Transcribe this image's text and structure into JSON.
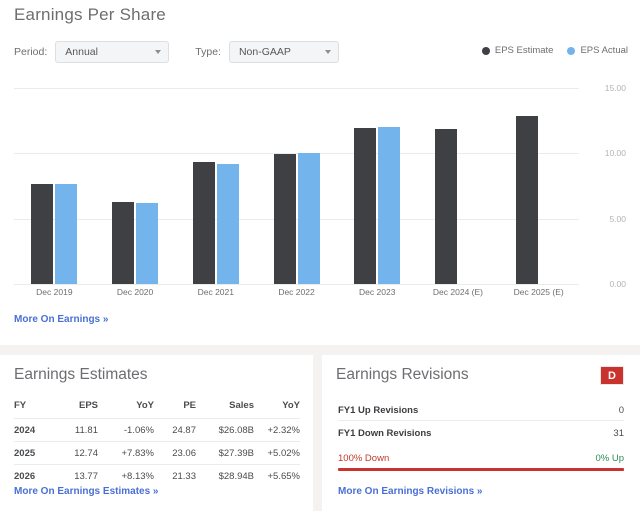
{
  "eps": {
    "title": "Earnings Per Share",
    "controls": {
      "period_label": "Period:",
      "period_value": "Annual",
      "type_label": "Type:",
      "type_value": "Non-GAAP"
    },
    "legend": [
      {
        "label": "EPS Estimate",
        "color": "#3f4044"
      },
      {
        "label": "EPS Actual",
        "color": "#74b4ec"
      }
    ],
    "more_link": "More On Earnings »"
  },
  "chart_data": {
    "type": "bar",
    "title": "Earnings Per Share",
    "xlabel": "",
    "ylabel": "",
    "ylim": [
      0,
      15
    ],
    "yticks": [
      "0.00",
      "5.00",
      "10.00",
      "15.00"
    ],
    "ytick_values": [
      0,
      5,
      10,
      15
    ],
    "grid": true,
    "legend_position": "top-right",
    "categories": [
      "Dec 2019",
      "Dec 2020",
      "Dec 2021",
      "Dec 2022",
      "Dec 2023",
      "Dec 2024 (E)",
      "Dec 2025 (E)"
    ],
    "series": [
      {
        "name": "EPS Estimate",
        "color": "#3f4044",
        "values": [
          7.65,
          6.25,
          9.3,
          9.95,
          11.95,
          11.9,
          12.85
        ]
      },
      {
        "name": "EPS Actual",
        "color": "#74b4ec",
        "values": [
          7.65,
          6.2,
          9.2,
          10.05,
          12.05,
          null,
          null
        ]
      }
    ]
  },
  "estimates": {
    "title": "Earnings Estimates",
    "columns": [
      "FY",
      "EPS",
      "YoY",
      "PE",
      "Sales",
      "YoY"
    ],
    "rows": [
      {
        "fy": "2024",
        "eps": "11.81",
        "yoy": "-1.06%",
        "yoy_sign": "neg",
        "pe": "24.87",
        "sales": "$26.08B",
        "sales_yoy": "+2.32%",
        "sales_yoy_sign": "pos"
      },
      {
        "fy": "2025",
        "eps": "12.74",
        "yoy": "+7.83%",
        "yoy_sign": "pos",
        "pe": "23.06",
        "sales": "$27.39B",
        "sales_yoy": "+5.02%",
        "sales_yoy_sign": "pos"
      },
      {
        "fy": "2026",
        "eps": "13.77",
        "yoy": "+8.13%",
        "yoy_sign": "pos",
        "pe": "21.33",
        "sales": "$28.94B",
        "sales_yoy": "+5.65%",
        "sales_yoy_sign": "pos"
      }
    ],
    "more_link": "More On Earnings Estimates »"
  },
  "revisions": {
    "title": "Earnings Revisions",
    "grade": "D",
    "grade_color": "#c9322d",
    "rows": [
      {
        "label": "FY1 Up Revisions",
        "value": "0"
      },
      {
        "label": "FY1 Down Revisions",
        "value": "31"
      }
    ],
    "down_pct_label": "100% Down",
    "up_pct_label": "0% Up",
    "down_pct": 100,
    "more_link": "More On Earnings Revisions »"
  }
}
